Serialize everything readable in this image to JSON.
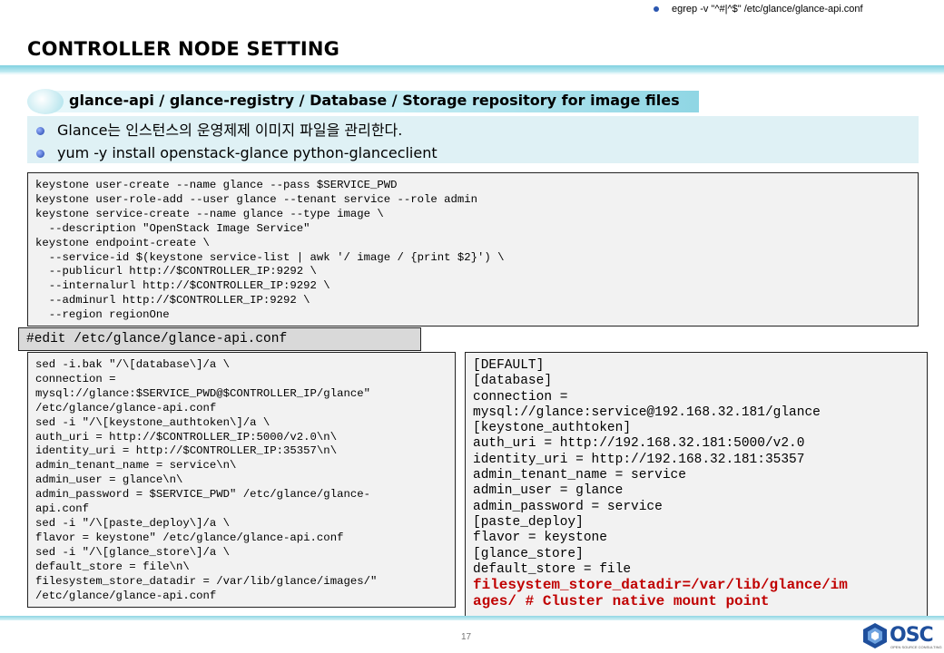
{
  "top_note": "egrep -v \"^#|^$\" /etc/glance/glance-api.conf",
  "title": "CONTROLLER NODE SETTING",
  "section_label": "glance-api / glance-registry / Database / Storage repository for image files",
  "bullets": [
    "Glance는 인스턴스의 운영제제 이미지 파일을 관리한다.",
    "yum -y install openstack-glance python-glanceclient"
  ],
  "code_block_1": "keystone user-create --name glance --pass $SERVICE_PWD\nkeystone user-role-add --user glance --tenant service --role admin\nkeystone service-create --name glance --type image \\\n  --description \"OpenStack Image Service\"\nkeystone endpoint-create \\\n  --service-id $(keystone service-list | awk '/ image / {print $2}') \\\n  --publicurl http://$CONTROLLER_IP:9292 \\\n  --internalurl http://$CONTROLLER_IP:9292 \\\n  --adminurl http://$CONTROLLER_IP:9292 \\\n  --region regionOne",
  "edit_label": "#edit /etc/glance/glance-api.conf",
  "code_block_2": "sed -i.bak \"/\\[database\\]/a \\\nconnection =\nmysql://glance:$SERVICE_PWD@$CONTROLLER_IP/glance\"\n/etc/glance/glance-api.conf\nsed -i \"/\\[keystone_authtoken\\]/a \\\nauth_uri = http://$CONTROLLER_IP:5000/v2.0\\n\\\nidentity_uri = http://$CONTROLLER_IP:35357\\n\\\nadmin_tenant_name = service\\n\\\nadmin_user = glance\\n\\\nadmin_password = $SERVICE_PWD\" /etc/glance/glance-\napi.conf\nsed -i \"/\\[paste_deploy\\]/a \\\nflavor = keystone\" /etc/glance/glance-api.conf\nsed -i \"/\\[glance_store\\]/a \\\ndefault_store = file\\n\\\nfilesystem_store_datadir = /var/lib/glance/images/\"\n/etc/glance/glance-api.conf",
  "code_block_3": "[DEFAULT]\n[database]\nconnection =\nmysql://glance:service@192.168.32.181/glance\n[keystone_authtoken]\nauth_uri = http://192.168.32.181:5000/v2.0\nidentity_uri = http://192.168.32.181:35357\nadmin_tenant_name = service\nadmin_user = glance\nadmin_password = service\n[paste_deploy]\nflavor = keystone\n[glance_store]\ndefault_store = file",
  "code_block_3_highlight": "filesystem_store_datadir=/var/lib/glance/im\nages/ # Cluster native mount point",
  "page_number": "17",
  "logo": {
    "text": "OSC",
    "subtext": "OPEN SOURCE CONSULTING",
    "color": "#1f4f9c"
  },
  "colors": {
    "accent": "#8fd6e4",
    "highlight": "#c00000",
    "bullet_bg": "#dff1f5"
  }
}
